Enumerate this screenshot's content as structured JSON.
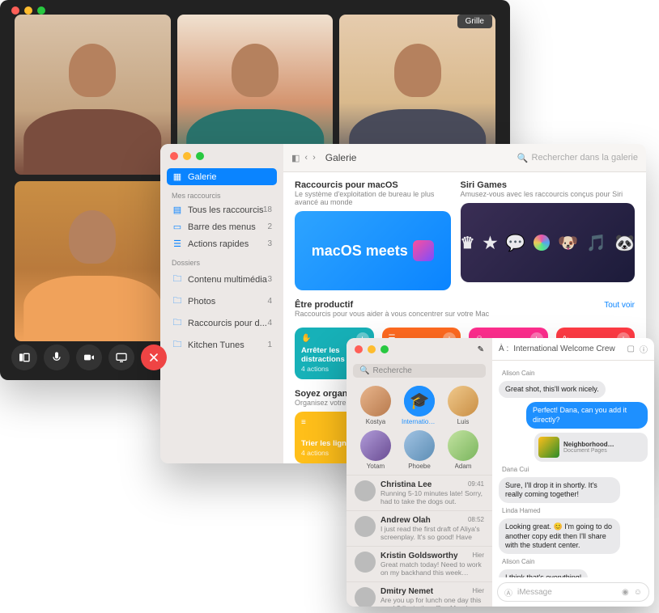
{
  "facetime": {
    "grid_label": "Grille",
    "toolbar": [
      "sidebar",
      "mute",
      "video",
      "screen",
      "end"
    ]
  },
  "shortcuts": {
    "sidebar": {
      "gallery": "Galerie",
      "section_my": "Mes raccourcis",
      "all": {
        "label": "Tous les raccourcis",
        "count": "18"
      },
      "menubar": {
        "label": "Barre des menus",
        "count": "2"
      },
      "quick": {
        "label": "Actions rapides",
        "count": "3"
      },
      "section_folders": "Dossiers",
      "f1": {
        "label": "Contenu multimédia",
        "count": "3"
      },
      "f2": {
        "label": "Photos",
        "count": "4"
      },
      "f3": {
        "label": "Raccourcis pour d...",
        "count": "4"
      },
      "f4": {
        "label": "Kitchen Tunes",
        "count": "1"
      }
    },
    "toolbar": {
      "crumb": "Galerie",
      "search_placeholder": "Rechercher dans la galerie"
    },
    "hero": {
      "left_title": "Raccourcis pour macOS",
      "left_sub": "Le système d'exploitation de bureau le plus avancé au monde",
      "left_banner": "macOS meets",
      "right_title": "Siri Games",
      "right_sub": "Amusez-vous avec les raccourcis conçus pour Siri"
    },
    "productive": {
      "title": "Être productif",
      "sub": "Raccourcis pour vous aider à vous concentrer sur votre Mac",
      "see_all": "Tout voir",
      "card1_title": "Arrêter les distractions",
      "card1_sub": "4 actions"
    },
    "organized": {
      "title": "Soyez organisé",
      "sub": "Organisez votre bureau, …",
      "card_title": "Trier les lignes",
      "card_sub": "4 actions"
    }
  },
  "messages": {
    "search_placeholder": "Recherche",
    "pins": [
      {
        "name": "Kostya"
      },
      {
        "name": "International…"
      },
      {
        "name": "Luis"
      },
      {
        "name": "Yotam"
      },
      {
        "name": "Phoebe"
      },
      {
        "name": "Adam"
      }
    ],
    "convos": [
      {
        "name": "Christina Lee",
        "time": "09:41",
        "preview": "Running 5-10 minutes late! Sorry, had to take the dogs out."
      },
      {
        "name": "Andrew Olah",
        "time": "08:52",
        "preview": "I just read the first draft of Aliya's screenplay. It's so good! Have you…"
      },
      {
        "name": "Kristin Goldsworthy",
        "time": "Hier",
        "preview": "Great match today! Need to work on my backhand this week…"
      },
      {
        "name": "Dmitry Nemet",
        "time": "Hier",
        "preview": "Are you up for lunch one day this week? I'm in the office Monday and Thursday…"
      }
    ],
    "thread": {
      "to_label": "À :",
      "to_name": "International Welcome Crew",
      "s1": "Alison Cain",
      "m1": "Great shot, this'll work nicely.",
      "m2": "Perfect! Dana, can you add it directly?",
      "link_title": "Neighborhood…",
      "link_sub": "Document Pages",
      "s2": "Dana Cui",
      "m3": "Sure, I'll drop it in shortly. It's really coming together!",
      "s3": "Linda Hamed",
      "m4": "Looking great. 😊 I'm going to do another copy edit then I'll share with the student center.",
      "s4": "Alison Cain",
      "m5": "I think that's everything!",
      "input_placeholder": "iMessage"
    }
  }
}
